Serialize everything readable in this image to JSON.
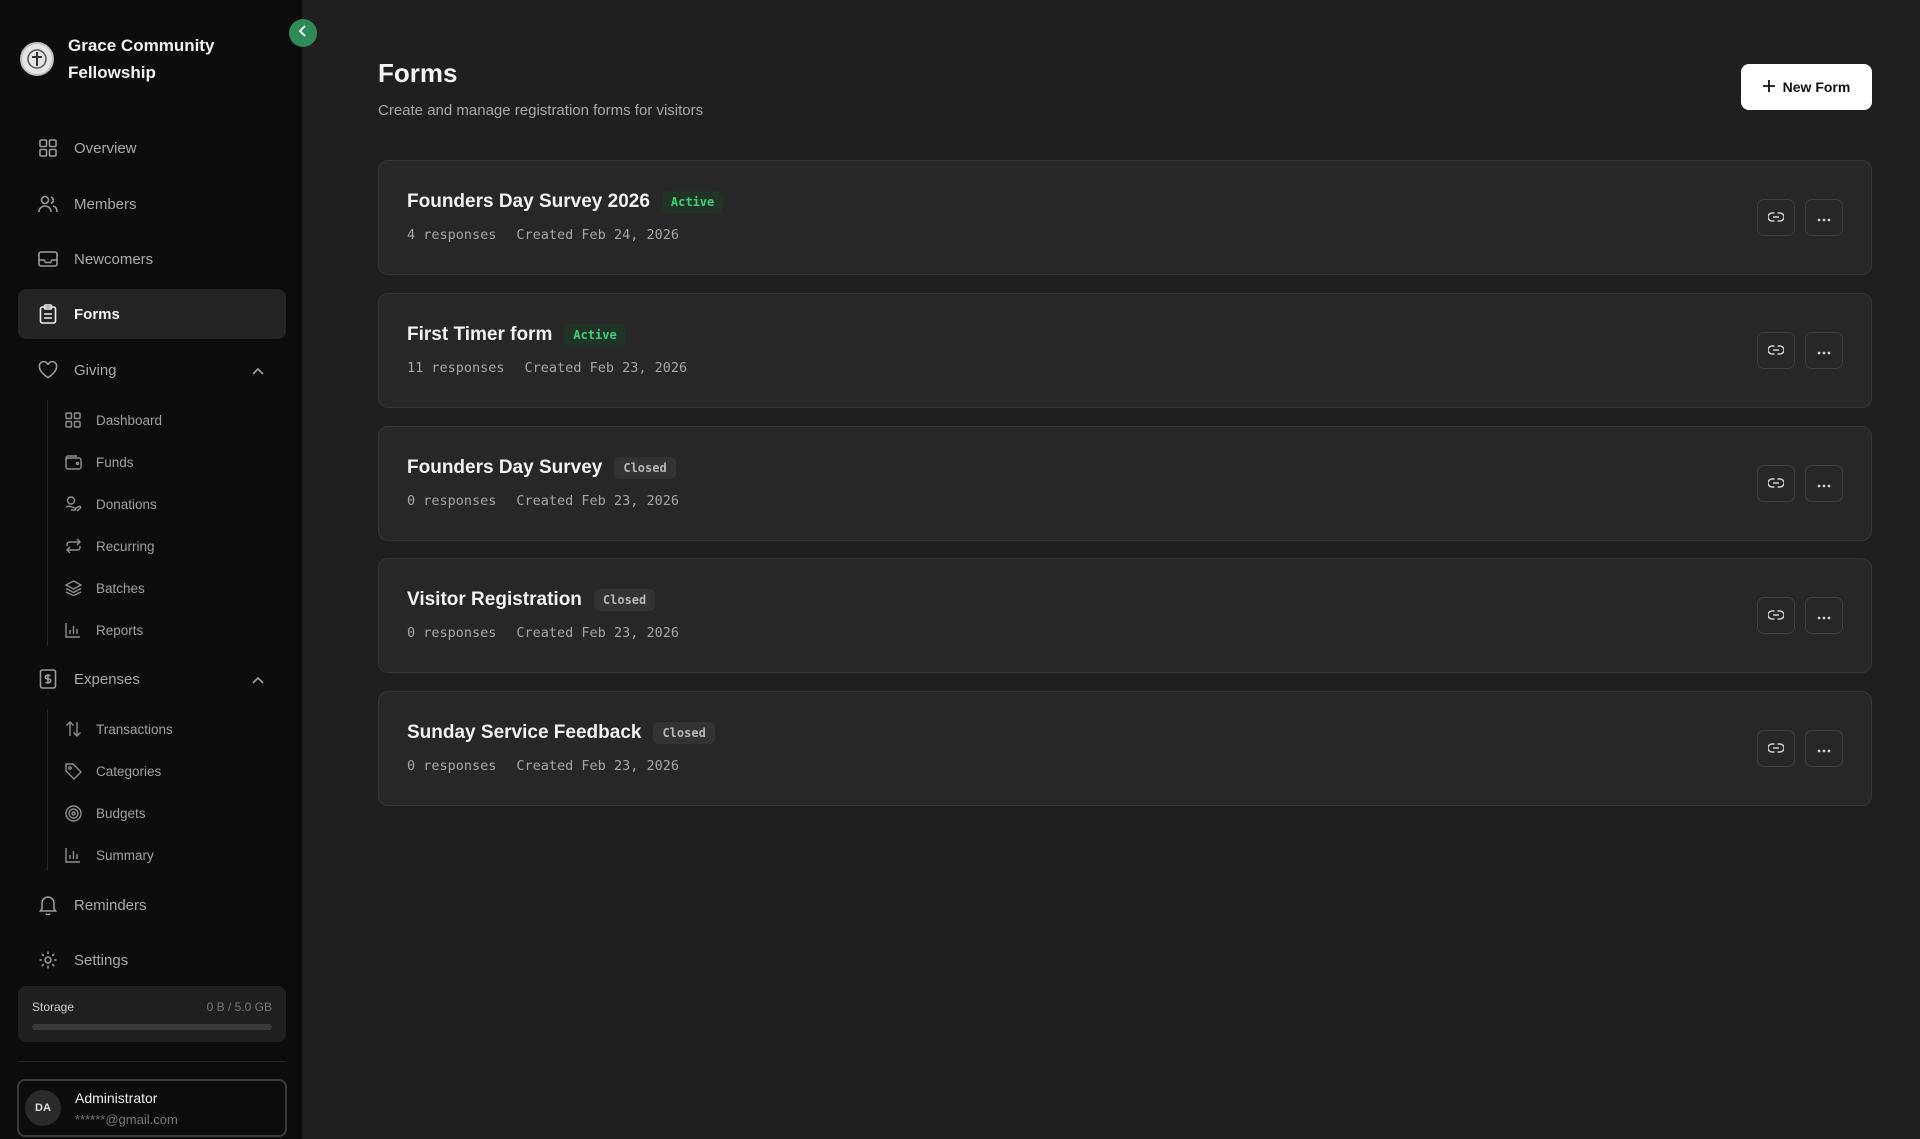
{
  "sidebar": {
    "brand_name": "Grace Community Fellowship",
    "nav": {
      "overview": "Overview",
      "members": "Members",
      "newcomers": "Newcomers",
      "forms": "Forms",
      "giving": "Giving",
      "expenses": "Expenses",
      "reminders": "Reminders",
      "settings": "Settings"
    },
    "giving_items": [
      "Dashboard",
      "Funds",
      "Donations",
      "Recurring",
      "Batches",
      "Reports"
    ],
    "expenses_items": [
      "Transactions",
      "Categories",
      "Budgets",
      "Summary"
    ],
    "storage": {
      "label": "Storage",
      "value": "0 B / 5.0 GB",
      "used_fraction": 0
    },
    "user": {
      "initials": "DA",
      "name": "Administrator",
      "email": "******@gmail.com"
    }
  },
  "header": {
    "title": "Forms",
    "subtitle": "Create and manage registration forms for visitors",
    "new_form_label": "New Form"
  },
  "forms": [
    {
      "title": "Founders Day Survey 2026",
      "status": "Active",
      "responses": "4 responses",
      "created": "Created Feb 24, 2026"
    },
    {
      "title": "First Timer form",
      "status": "Active",
      "responses": "11 responses",
      "created": "Created Feb 23, 2026"
    },
    {
      "title": "Founders Day Survey",
      "status": "Closed",
      "responses": "0 responses",
      "created": "Created Feb 23, 2026"
    },
    {
      "title": "Visitor Registration",
      "status": "Closed",
      "responses": "0 responses",
      "created": "Created Feb 23, 2026"
    },
    {
      "title": "Sunday Service Feedback",
      "status": "Closed",
      "responses": "0 responses",
      "created": "Created Feb 23, 2026"
    }
  ],
  "colors": {
    "accent": "#2f8a57",
    "active_badge_text": "#3ecf7a",
    "sidebar_bg": "#0c0c0c",
    "main_bg": "#1f1f1f",
    "card_bg": "#272727"
  }
}
